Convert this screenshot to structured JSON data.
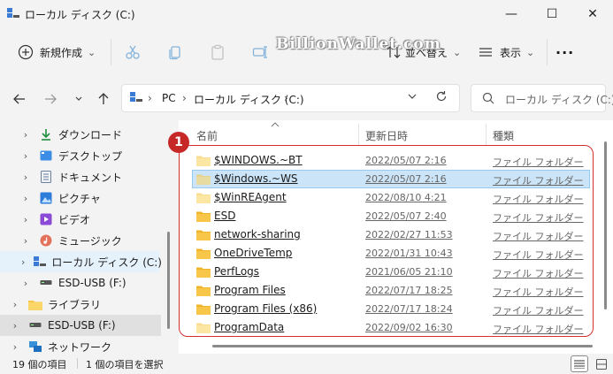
{
  "window": {
    "title": "ローカル ディスク (C:)",
    "minimize": "—",
    "maximize": "☐",
    "close": "✕"
  },
  "toolbar": {
    "new_label": "新規作成",
    "new_chevron": "⌄",
    "sort_label": "並べ替え",
    "view_label": "表示",
    "more": "···"
  },
  "watermark": "BillionWallet.com",
  "address": {
    "segments": [
      "PC",
      "ローカル ディスク (C:)"
    ],
    "separator": "›"
  },
  "search": {
    "placeholder": "ローカル ディスク (C:)..."
  },
  "sidebar": {
    "items": [
      {
        "label": "ダウンロード",
        "icon": "download-icon"
      },
      {
        "label": "デスクトップ",
        "icon": "desktop-icon"
      },
      {
        "label": "ドキュメント",
        "icon": "document-icon"
      },
      {
        "label": "ピクチャ",
        "icon": "picture-icon"
      },
      {
        "label": "ビデオ",
        "icon": "video-icon"
      },
      {
        "label": "ミュージック",
        "icon": "music-icon"
      },
      {
        "label": "ローカル ディスク (C:)",
        "icon": "drive-c-icon"
      },
      {
        "label": "ESD-USB (F:)",
        "icon": "usb-drive-icon"
      },
      {
        "label": "ライブラリ",
        "icon": "library-icon"
      },
      {
        "label": "ESD-USB (F:)",
        "icon": "usb-drive-icon"
      },
      {
        "label": "ネットワーク",
        "icon": "network-icon"
      }
    ]
  },
  "columns": {
    "name": "名前",
    "date": "更新日時",
    "type": "種類"
  },
  "badge": "1",
  "files": [
    {
      "name": "$WINDOWS.~BT",
      "date": "2022/05/07 2:16",
      "type": "ファイル フォルダー"
    },
    {
      "name": "$Windows.~WS",
      "date": "2022/05/07 2:16",
      "type": "ファイル フォルダー"
    },
    {
      "name": "$WinREAgent",
      "date": "2022/08/10 4:21",
      "type": "ファイル フォルダー"
    },
    {
      "name": "ESD",
      "date": "2022/05/07 2:40",
      "type": "ファイル フォルダー"
    },
    {
      "name": "network-sharing",
      "date": "2022/02/27 11:53",
      "type": "ファイル フォルダー"
    },
    {
      "name": "OneDriveTemp",
      "date": "2022/01/31 10:43",
      "type": "ファイル フォルダー"
    },
    {
      "name": "PerfLogs",
      "date": "2021/06/05 21:10",
      "type": "ファイル フォルダー"
    },
    {
      "name": "Program Files",
      "date": "2022/07/17 18:25",
      "type": "ファイル フォルダー"
    },
    {
      "name": "Program Files (x86)",
      "date": "2022/07/17 18:24",
      "type": "ファイル フォルダー"
    },
    {
      "name": "ProgramData",
      "date": "2022/09/02 16:30",
      "type": "ファイル フォルダー"
    }
  ],
  "status": {
    "count": "19 個の項目",
    "selected": "1 個の項目を選択"
  },
  "colors": {
    "selection": "#cce4f7",
    "accent": "#0067c0",
    "highlight": "#d32f2f",
    "folder": "#f8c74a"
  }
}
